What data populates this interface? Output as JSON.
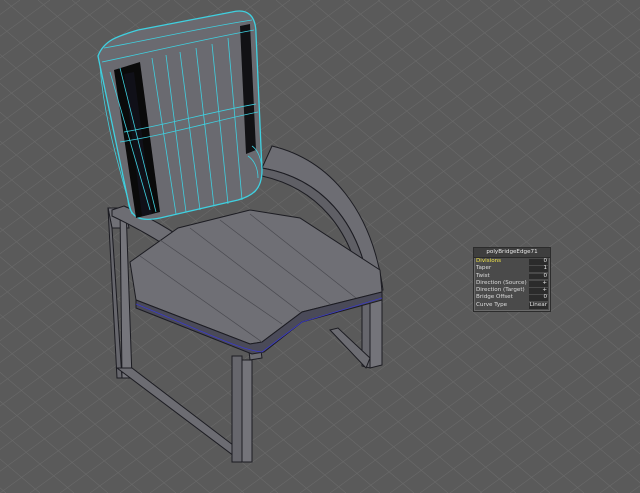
{
  "viewport": {
    "background": "#5a5a5a",
    "grid_color": "#6a6a6a",
    "highlight_color": "#3fd0e0",
    "mesh_color": "#6f6f74",
    "edge_color": "#1c1c22"
  },
  "hud": {
    "title": "polyBridgeEdge71",
    "rows": [
      {
        "label": "Divisions",
        "value": "0",
        "active": true
      },
      {
        "label": "Taper",
        "value": "1",
        "active": false
      },
      {
        "label": "Twist",
        "value": "0",
        "active": false
      },
      {
        "label": "Direction (Source)",
        "value": "+",
        "active": false
      },
      {
        "label": "Direction (Target)",
        "value": "+",
        "active": false
      },
      {
        "label": "Bridge Offset",
        "value": "0",
        "active": false
      },
      {
        "label": "Curve Type",
        "value": "Linear",
        "active": false
      }
    ]
  }
}
